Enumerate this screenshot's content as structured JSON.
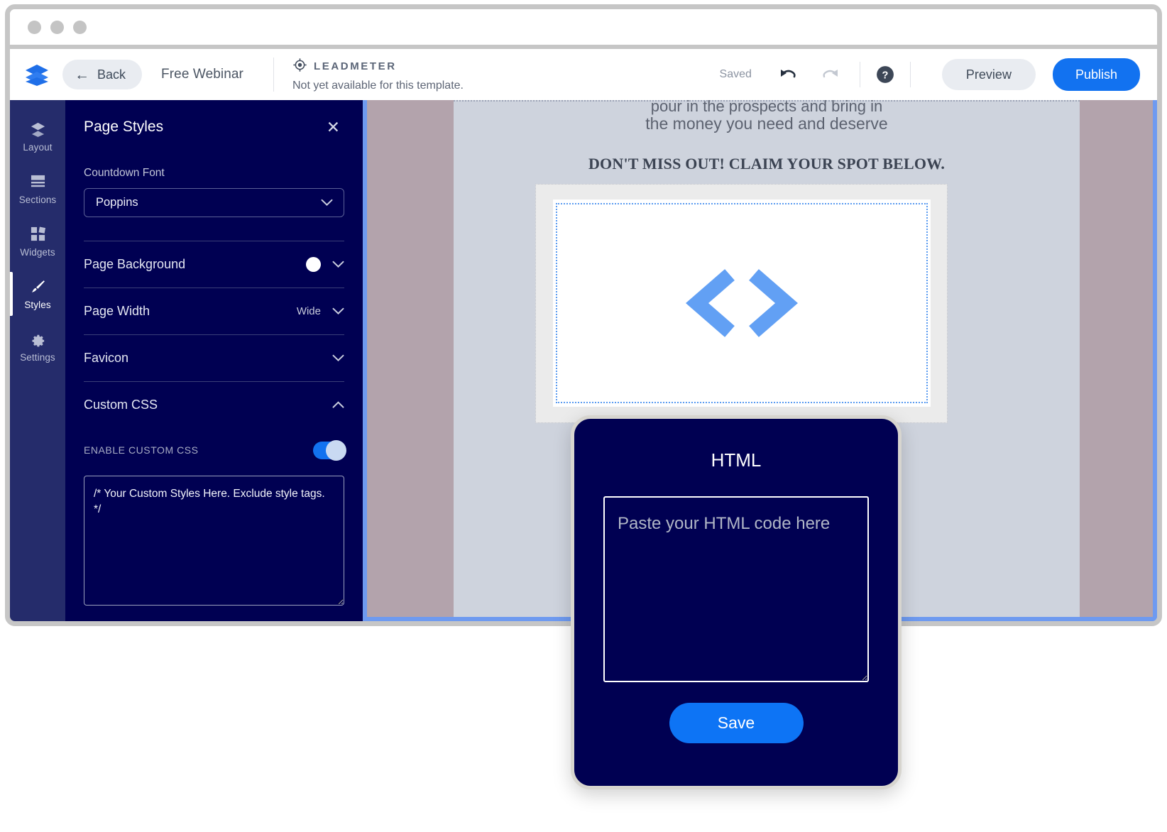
{
  "window": {
    "dots": [
      "close",
      "minimize",
      "maximize"
    ]
  },
  "appbar": {
    "logo_icon": "layers-logo-icon",
    "back_label": "Back",
    "back_arrow_icon": "arrow-left-icon",
    "project_title": "Free Webinar",
    "leadmeter": {
      "icon": "target-crosshair-icon",
      "name": "LEADMETER",
      "note": "Not yet available for this template."
    },
    "saved_label": "Saved",
    "undo_icon": "undo-arrow-icon",
    "redo_icon": "redo-arrow-icon",
    "help_icon": "question-mark-circle-icon",
    "preview_label": "Preview",
    "publish_label": "Publish",
    "publish_color": "#1272f0"
  },
  "rail": {
    "items": [
      {
        "label": "Layout",
        "icon": "layers-icon",
        "active": false
      },
      {
        "label": "Sections",
        "icon": "rows-icon",
        "active": false
      },
      {
        "label": "Widgets",
        "icon": "grid-icon",
        "active": false
      },
      {
        "label": "Styles",
        "icon": "paintbrush-icon",
        "active": true
      },
      {
        "label": "Settings",
        "icon": "gear-icon",
        "active": false
      }
    ]
  },
  "panel": {
    "title": "Page Styles",
    "close_icon": "close-x-icon",
    "countdown_font": {
      "label": "Countdown Font",
      "value": "Poppins",
      "chevron": "chevron-down-icon"
    },
    "rows": [
      {
        "label": "Page Background",
        "value": "",
        "swatch": "#ffffff",
        "chevron": "chevron-down-icon"
      },
      {
        "label": "Page Width",
        "value": "Wide",
        "swatch": null,
        "chevron": "chevron-down-icon"
      },
      {
        "label": "Favicon",
        "value": "",
        "swatch": null,
        "chevron": "chevron-down-icon"
      }
    ],
    "custom_css": {
      "label": "Custom CSS",
      "chevron": "chevron-up-icon",
      "enable_label": "ENABLE CUSTOM CSS",
      "toggle_on": true,
      "toggle_color": "#1272f0",
      "textarea_value": "/* Your Custom Styles Here. Exclude style tags. */"
    }
  },
  "canvas": {
    "clipped_line": "pour in the prospects and bring in",
    "subhead": "the money you need and deserve",
    "cta_heading": "DON'T MISS OUT! CLAIM YOUR SPOT BELOW.",
    "widget_icon": "code-brackets-icon",
    "page_background": "#ced3dd",
    "body_background": "#b3a3ac",
    "selection_color": "#5a9bf0"
  },
  "modal": {
    "title": "HTML",
    "textarea_placeholder": "Paste your HTML code here",
    "textarea_value": "",
    "save_label": "Save",
    "save_color": "#0d74f5"
  }
}
